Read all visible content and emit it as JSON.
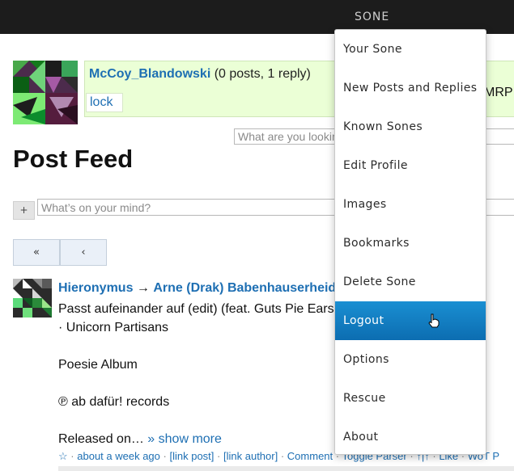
{
  "topbar": {
    "menu_title": "SONE"
  },
  "profile": {
    "username": "McCoy_Blandowski",
    "stats": " (0 posts, 1 reply)",
    "lock_label": "lock",
    "side_text": "MRP"
  },
  "search": {
    "placeholder": "What are you looking for?"
  },
  "page": {
    "title": "Post Feed"
  },
  "post_form": {
    "plus_label": "+",
    "placeholder": "What’s on your mind?"
  },
  "pager": {
    "first_label": "«",
    "prev_label": "‹"
  },
  "post": {
    "author": "Hieronymus",
    "arrow": " → ",
    "recipient": "Arne (Drak) Babenhauserheide",
    "line1": "Passt aufeinander auf (edit) (feat. Guts Pie Earshot) · Früchte",
    "line2": "· Unicorn Partisans",
    "line3": "Poesie Album",
    "line4": "℗ ab dafür! records",
    "line5": "Released on… ",
    "show_more": "» show more",
    "meta": {
      "star": "☆",
      "time": "about a week ago",
      "link_post": "[link post]",
      "link_author": "[link author]",
      "comment": "Comment",
      "toggle_parser": "Toggle Parser",
      "mark": "↑|↑",
      "like": "Like",
      "wot": "WoT P"
    }
  },
  "menu": {
    "items": [
      {
        "label": "Your Sone"
      },
      {
        "label": "New Posts and Replies"
      },
      {
        "label": "Known Sones"
      },
      {
        "label": "Edit Profile"
      },
      {
        "label": "Images"
      },
      {
        "label": "Bookmarks"
      },
      {
        "label": "Delete Sone"
      },
      {
        "label": "Logout"
      },
      {
        "label": "Options"
      },
      {
        "label": "Rescue"
      },
      {
        "label": "About"
      }
    ],
    "active_item": "Logout",
    "active_color": "#127dc3"
  }
}
